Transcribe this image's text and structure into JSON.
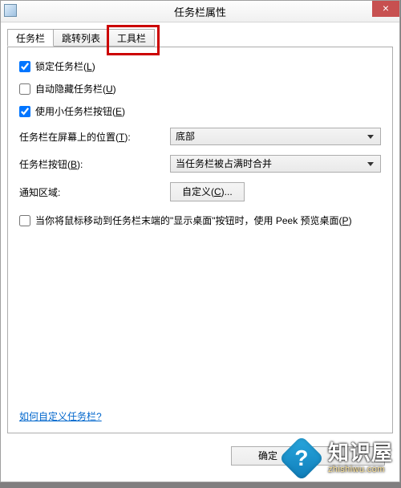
{
  "window": {
    "title": "任务栏属性",
    "close_glyph": "×"
  },
  "tabs": {
    "items": [
      {
        "label": "任务栏"
      },
      {
        "label": "跳转列表"
      },
      {
        "label": "工具栏"
      }
    ],
    "active_index": 0
  },
  "taskbar_tab": {
    "lock": {
      "checked": true,
      "label_pre": "锁定任务栏(",
      "accel": "L",
      "label_post": ")"
    },
    "autohide": {
      "checked": false,
      "label_pre": "自动隐藏任务栏(",
      "accel": "U",
      "label_post": ")"
    },
    "smallbtn": {
      "checked": true,
      "label_pre": "使用小任务栏按钮(",
      "accel": "E",
      "label_post": ")"
    },
    "location": {
      "label_pre": "任务栏在屏幕上的位置(",
      "accel": "T",
      "label_post": "):",
      "value": "底部"
    },
    "buttons": {
      "label_pre": "任务栏按钮(",
      "accel": "B",
      "label_post": "):",
      "value": "当任务栏被占满时合并"
    },
    "notify": {
      "label_pre": "通知区域:",
      "btn_pre": "自定义(",
      "btn_accel": "C",
      "btn_post": ")..."
    },
    "peek": {
      "checked": false,
      "text_pre": "当你将鼠标移动到任务栏末端的\"显示桌面\"按钮时，使用 Peek 预览桌面(",
      "accel": "P",
      "label_post": ")"
    },
    "help_link": "如何自定义任务栏?"
  },
  "dialog_buttons": {
    "ok": "确定",
    "cancel_partial": ""
  },
  "watermark": {
    "text": "知识屋",
    "url": "zhishiwu.com",
    "q": "?"
  }
}
